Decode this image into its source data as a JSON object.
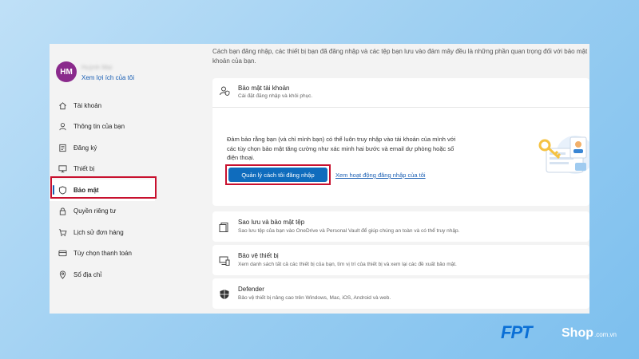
{
  "intro_text": "Cách bạn đăng nhập, các thiết bị bạn đã đăng nhập và các tệp bạn lưu vào đám mây đều là những phần quan trọng đối với bảo mật khoản của bạn.",
  "profile": {
    "initials": "HM",
    "name": "Huỳnh Mai",
    "link": "Xem lợi ích của tôi",
    "avatar_color": "#8a2a8c"
  },
  "sidebar": {
    "items": [
      {
        "label": "Tài khoản",
        "icon": "home-icon"
      },
      {
        "label": "Thông tin của bạn",
        "icon": "person-icon"
      },
      {
        "label": "Đăng ký",
        "icon": "subscription-icon"
      },
      {
        "label": "Thiết bị",
        "icon": "monitor-icon"
      },
      {
        "label": "Bảo mật",
        "icon": "shield-icon",
        "active": true
      },
      {
        "label": "Quyền riêng tư",
        "icon": "lock-icon"
      },
      {
        "label": "Lịch sử đơn hàng",
        "icon": "cart-icon"
      },
      {
        "label": "Tùy chọn thanh toán",
        "icon": "card-icon"
      },
      {
        "label": "Sổ địa chỉ",
        "icon": "location-icon"
      }
    ]
  },
  "security_card": {
    "title": "Bảo mật tài khoản",
    "desc": "Cài đặt đăng nhập và khôi phục.",
    "body": "Đảm bảo rằng bạn (và chỉ mình bạn) có thể luôn truy nhập vào tài khoản của mình với các tùy chọn bảo mật tăng cường như xác minh hai bước và email dự phòng hoặc số điện thoại.",
    "primary_button": "Quản lý cách tôi đăng nhập",
    "link": "Xem hoạt động đăng nhập của tôi"
  },
  "rows": [
    {
      "title": "Sao lưu và bảo mật tệp",
      "desc": "Sao lưu tệp của bạn vào OneDrive và Personal Vault để giúp chúng an toàn và có thể truy nhập.",
      "icon": "files-icon"
    },
    {
      "title": "Bảo vệ thiết bị",
      "desc": "Xem danh sách tất cả các thiết bị của bạn, tìm vị trí của thiết bị và xem lại các đề xuất bảo mật.",
      "icon": "device-icon"
    },
    {
      "title": "Defender",
      "desc": "Bảo vệ thiết bị nâng cao trên Windows, Mac, iOS, Android và web.",
      "icon": "defender-shield-icon"
    }
  ],
  "brand": {
    "fpt": "FPT",
    "shop": "Shop",
    "domain": ".com.vn"
  },
  "colors": {
    "accent": "#0f6cbd",
    "highlight": "#c8102e",
    "link": "#1a5fb4"
  }
}
